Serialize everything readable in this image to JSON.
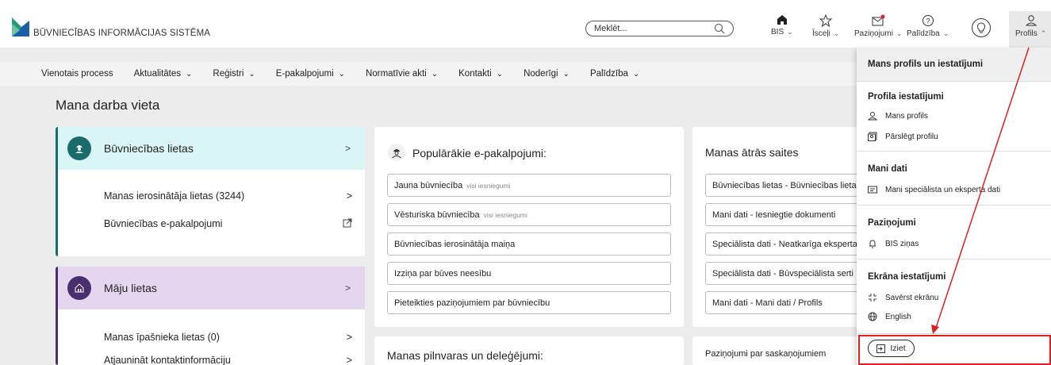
{
  "header": {
    "brand": "BŪVNIECĪBAS INFORMĀCIJAS SISTĒMA",
    "search_placeholder": "Meklēt...",
    "icons": [
      {
        "label": "BIS",
        "icon": "home-icon"
      },
      {
        "label": "Īsceļi",
        "icon": "star-icon"
      },
      {
        "label": "Paziņojumi",
        "icon": "mail-icon"
      },
      {
        "label": "Palīdzība",
        "icon": "help-icon"
      },
      {
        "label": "Profils",
        "icon": "user-icon"
      }
    ]
  },
  "nav": [
    {
      "label": "Vienotais process",
      "chev": false
    },
    {
      "label": "Aktualitātes",
      "chev": true
    },
    {
      "label": "Reģistri",
      "chev": true
    },
    {
      "label": "E-pakalpojumi",
      "chev": true
    },
    {
      "label": "Normatīvie akti",
      "chev": true
    },
    {
      "label": "Kontakti",
      "chev": true
    },
    {
      "label": "Noderīgi",
      "chev": true
    },
    {
      "label": "Palīdzība",
      "chev": true
    }
  ],
  "page_title": "Mana darba vieta",
  "card1": {
    "title": "Būvniecības lietas",
    "rows": [
      "Manas ierosinātāja lietas (3244)",
      "Būvniecības e-pakalpojumi"
    ]
  },
  "card2": {
    "title": "Māju lietas",
    "rows": [
      "Manas īpašnieka lietas (0)",
      "Atjaunināt kontaktinformāciju"
    ]
  },
  "popular": {
    "title": "Populārākie e-pakalpojumi:",
    "items": [
      {
        "label": "Jauna būvniecība",
        "tag": "visi iesniegumi"
      },
      {
        "label": "Vēsturiska būvniecība",
        "tag": "visi iesniegumi"
      },
      {
        "label": "Būvniecības ierosinātāja maiņa",
        "tag": ""
      },
      {
        "label": "Izziņa par būves neesību",
        "tag": ""
      },
      {
        "label": "Pieteikties paziņojumiem par būvniecību",
        "tag": ""
      }
    ]
  },
  "powers_title": "Manas pilnvaras un deleģējumi:",
  "quick": {
    "title": "Manas ātrās saites",
    "items": [
      "Būvniecības lietas - Būvniecības lietas",
      "Mani dati - Iesniegtie dokumenti",
      "Speciālista dati - Neatkarīga eksperta",
      "Speciālista dati - Būvspeciālista serti",
      "Mani dati - Mani dati / Profils"
    ]
  },
  "approvals_title": "Paziņojumi par saskaņojumiem",
  "dropdown": {
    "header": "Mans profils un iestatījumi",
    "sections": [
      {
        "title": "Profila iestatījumi",
        "items": [
          "Mans profils",
          "Pārslēgt profilu"
        ]
      },
      {
        "title": "Mani dati",
        "items": [
          "Mani speciālista un eksperta dati"
        ]
      },
      {
        "title": "Paziņojumi",
        "items": [
          "BIS ziņas"
        ]
      },
      {
        "title": "Ekrāna iestatījumi",
        "items": [
          "Savērst ekrānu",
          "English"
        ]
      }
    ],
    "logout": "Iziet"
  },
  "colors": {
    "teal": "#1a6b6b",
    "purple": "#4a2f6f",
    "annotation_red": "#e02020"
  }
}
